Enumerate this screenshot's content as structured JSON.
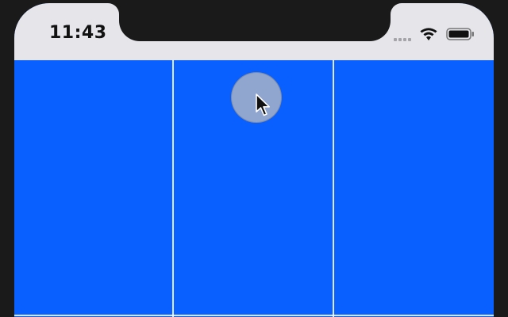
{
  "status_bar": {
    "time": "11:43",
    "signal_icon": "cellular-signal-icon",
    "wifi_icon": "wifi-icon",
    "battery_icon": "battery-icon"
  },
  "grid": {
    "columns": 3,
    "cell_color": "#0a60ff",
    "line_color": "#ffffff"
  },
  "touch": {
    "icon": "touch-indicator-icon",
    "cursor_icon": "mouse-pointer-icon"
  }
}
